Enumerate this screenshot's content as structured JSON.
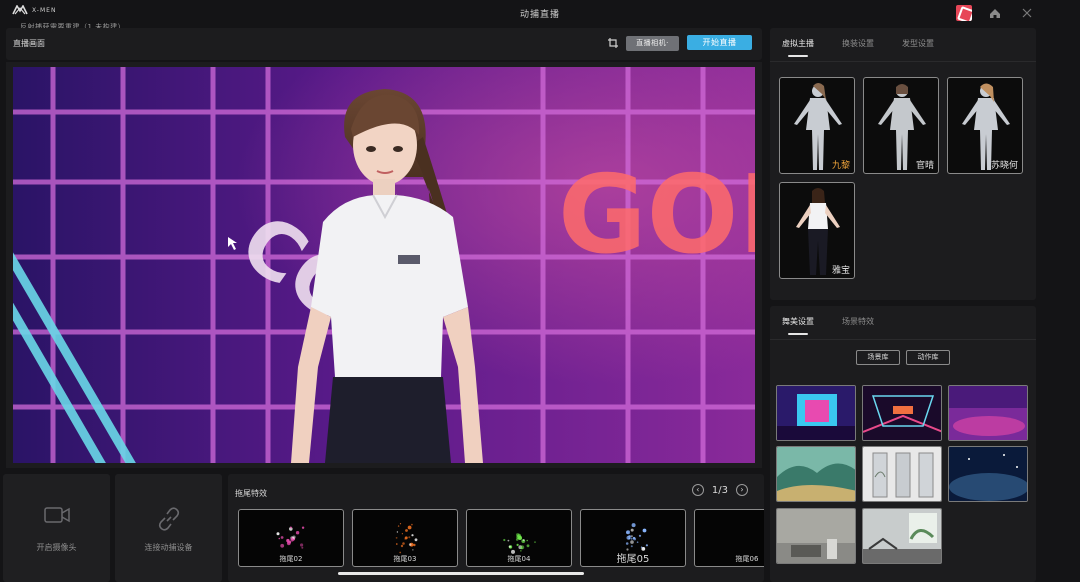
{
  "window": {
    "logo_text": "X-MEN",
    "notice": "反射捕获需要重建（1 未构建）",
    "title": "动捕直播"
  },
  "live": {
    "title": "直播画面",
    "camera_button": "直播相机·",
    "start_button": "开始直播",
    "scene_text_right": "GOD",
    "scene_text_left": "CC"
  },
  "tiles": {
    "camera": "开启摄像头",
    "link": "连接动捕设备"
  },
  "effects": {
    "title": "拖尾特效",
    "page": "1/3",
    "items": [
      {
        "label": "拖尾02",
        "color": "#e04aa8"
      },
      {
        "label": "拖尾03",
        "color": "#f07020"
      },
      {
        "label": "拖尾04",
        "color": "#6ee84a"
      },
      {
        "label": "拖尾05",
        "color": "#8ab6ff"
      },
      {
        "label": "拖尾06",
        "color": "#ffb030"
      }
    ]
  },
  "avatar_panel": {
    "tabs": [
      "虚拟主播",
      "换装设置",
      "发型设置"
    ],
    "avatars": [
      {
        "name": "九黎",
        "selected": true
      },
      {
        "name": "官晴",
        "selected": false
      },
      {
        "name": "苏晓何",
        "selected": false
      },
      {
        "name": "雅宝",
        "selected": false
      }
    ]
  },
  "stage_panel": {
    "tabs": [
      "舞美设置",
      "场景特效"
    ],
    "scene_library": "场景库",
    "action_library": "动作库"
  },
  "colors": {
    "accent": "#3aaee3",
    "selected_name": "#f0a43a",
    "panel": "#1c1c1e",
    "background": "#141416"
  }
}
